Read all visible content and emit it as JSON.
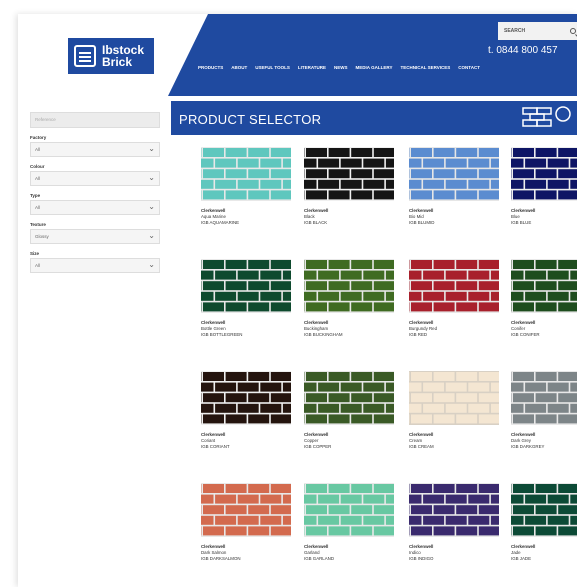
{
  "header": {
    "logo_line1": "Ibstock",
    "logo_line2": "Brick",
    "search_label": "SEARCH",
    "phone": "t. 0844 800 457",
    "nav": [
      "PRODUCTS",
      "ABOUT",
      "USEFUL TOOLS",
      "LITERATURE",
      "NEWS",
      "MEDIA GALLERY",
      "TECHNICAL SERVICES",
      "CONTACT"
    ]
  },
  "sidebar": {
    "reference_placeholder": "Reference",
    "filters": [
      {
        "label": "Factory",
        "value": "All"
      },
      {
        "label": "Colour",
        "value": "All"
      },
      {
        "label": "Type",
        "value": "All"
      },
      {
        "label": "Texture",
        "value": "Glossy"
      },
      {
        "label": "Size",
        "value": "All"
      }
    ]
  },
  "main": {
    "title": "PRODUCT SELECTOR",
    "products": [
      {
        "range": "Clerkenwell",
        "name": "Aqua Marine",
        "code": "IGB AQUAMARINE",
        "color": "#5fc7be",
        "mortar": "#e8e8e8"
      },
      {
        "range": "Clerkenwell",
        "name": "Black",
        "code": "IGB BLACK",
        "color": "#151515",
        "mortar": "#f0f0f0"
      },
      {
        "range": "Clerkenwell",
        "name": "Bio Mid",
        "code": "IGB BLUMID",
        "color": "#5b8cd0",
        "mortar": "#e6e6e6"
      },
      {
        "range": "Clerkenwell",
        "name": "Blue",
        "code": "IGB BLUE",
        "color": "#0e1565",
        "mortar": "#eeeeee"
      },
      {
        "range": "Clerkenwell",
        "name": "Bottle Green",
        "code": "IGB BOTTLEGREEN",
        "color": "#0e4a2e",
        "mortar": "#e8e8e8"
      },
      {
        "range": "Clerkenwell",
        "name": "Buckingham",
        "code": "IGB BUCKINGHAM",
        "color": "#3f6b22",
        "mortar": "#e8e8e8"
      },
      {
        "range": "Clerkenwell",
        "name": "Burgundy Red",
        "code": "IGB RED",
        "color": "#a8202c",
        "mortar": "#e8e8e8"
      },
      {
        "range": "Clerkenwell",
        "name": "Conifer",
        "code": "IGB CONIFER",
        "color": "#1e4d1e",
        "mortar": "#e8e8e8"
      },
      {
        "range": "Clerkenwell",
        "name": "Coriant",
        "code": "IGB CORIANT",
        "color": "#24140e",
        "mortar": "#efefef"
      },
      {
        "range": "Clerkenwell",
        "name": "Copper",
        "code": "IGB COPPER",
        "color": "#3a5a26",
        "mortar": "#e8e8e8"
      },
      {
        "range": "Clerkenwell",
        "name": "Cream",
        "code": "IGB CREAM",
        "color": "#f4e6d2",
        "mortar": "#d8d0c4"
      },
      {
        "range": "Clerkenwell",
        "name": "Dark Grey",
        "code": "IGB DARKGREY",
        "color": "#7d8588",
        "mortar": "#e8e8e8"
      },
      {
        "range": "Clerkenwell",
        "name": "Dark Salmon",
        "code": "IGB DARKSALMON",
        "color": "#d36a4e",
        "mortar": "#e8e8e8"
      },
      {
        "range": "Clerkenwell",
        "name": "Garland",
        "code": "IGB GARLAND",
        "color": "#68c8a2",
        "mortar": "#e8e8e8"
      },
      {
        "range": "Clerkenwell",
        "name": "Indico",
        "code": "IGB INDIGO",
        "color": "#3a2a6e",
        "mortar": "#e8e8e8"
      },
      {
        "range": "Clerkenwell",
        "name": "Jade",
        "code": "IGB JADE",
        "color": "#0c4a36",
        "mortar": "#e8e8e8"
      }
    ]
  }
}
